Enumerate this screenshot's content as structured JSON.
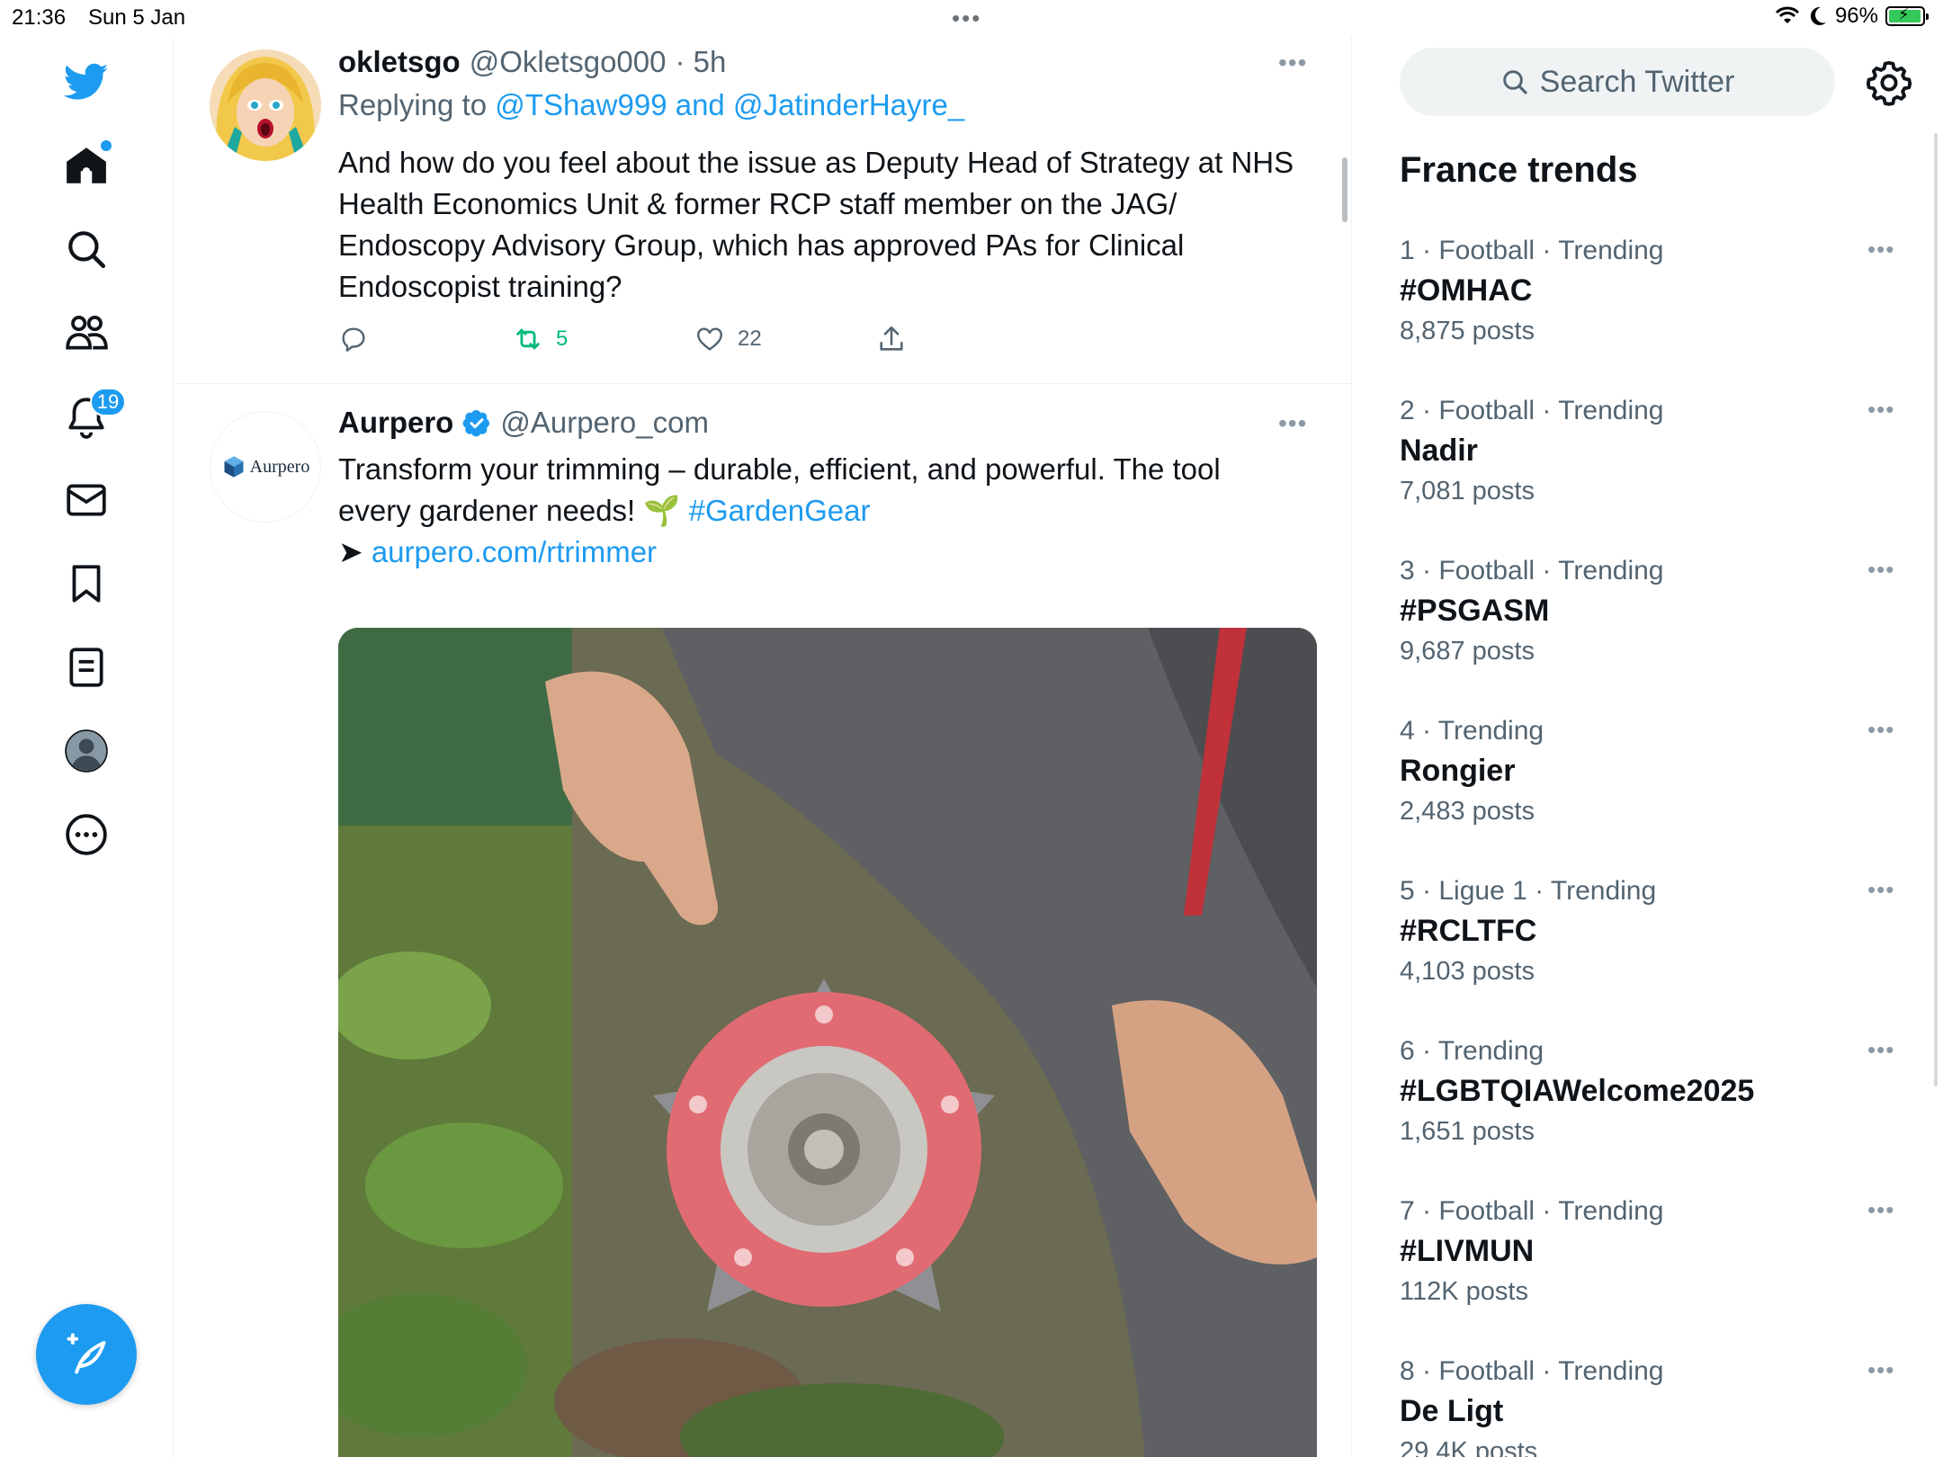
{
  "status_bar": {
    "time": "21:36",
    "date": "Sun 5 Jan",
    "battery_percent": "96%",
    "battery_level": 0.96
  },
  "nav": {
    "notifications_badge": "19",
    "icons": [
      "twitter-logo-icon",
      "home-icon",
      "search-icon",
      "communities-icon",
      "notifications-icon",
      "messages-icon",
      "bookmarks-icon",
      "lists-icon",
      "profile-icon",
      "more-icon",
      "compose-icon"
    ]
  },
  "tweets": [
    {
      "name": "okletsgo",
      "handle": "@Okletsgo000",
      "time": "· 5h",
      "replying_prefix": "Replying to",
      "replying_to": "@TShaw999 and @JatinderHayre_",
      "text": "And how do you feel about the issue as Deputy Head of Strategy at NHS Health Economics Unit & former RCP staff member on the JAG/ Endoscopy Advisory Group, which has approved PAs for Clinical Endoscopist training?",
      "retweets": "5",
      "likes": "22"
    },
    {
      "name": "Aurpero",
      "handle": "@Aurpero_com",
      "avatar_text": "Aurpero",
      "text_main": "Transform your trimming – durable, efficient, and powerful. The tool every gardener needs! 🌱",
      "hashtag": "#GardenGear",
      "arrow": "➤",
      "link": "aurpero.com/rtrimmer"
    }
  ],
  "right": {
    "search_placeholder": "Search Twitter",
    "title": "France trends",
    "trends": [
      {
        "meta": "1 · Football · Trending",
        "name": "#OMHAC",
        "count": "8,875 posts"
      },
      {
        "meta": "2 · Football · Trending",
        "name": "Nadir",
        "count": "7,081 posts"
      },
      {
        "meta": "3 · Football · Trending",
        "name": "#PSGASM",
        "count": "9,687 posts"
      },
      {
        "meta": "4 · Trending",
        "name": "Rongier",
        "count": "2,483 posts"
      },
      {
        "meta": "5 · Ligue 1 · Trending",
        "name": "#RCLTFC",
        "count": "4,103 posts"
      },
      {
        "meta": "6 · Trending",
        "name": "#LGBTQIAWelcome2025",
        "count": "1,651 posts"
      },
      {
        "meta": "7 · Football · Trending",
        "name": "#LIVMUN",
        "count": "112K posts"
      },
      {
        "meta": "8 · Football · Trending",
        "name": "De Ligt",
        "count": "29.4K posts"
      }
    ]
  },
  "colors": {
    "accent": "#1d9bf0",
    "retweet": "#00ba7c",
    "secondary_text": "#536471"
  }
}
